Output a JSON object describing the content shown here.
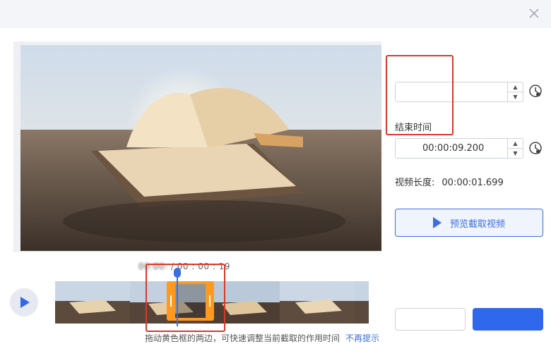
{
  "dialog": {
    "close_icon": "close-icon"
  },
  "timeline": {
    "current_time": "00:00:",
    "separator": " / ",
    "total_time": "00 : 00 : 19",
    "hint": "拖动黄色框的两边，可快速调整当前截取的作用时间",
    "hint_link": "不再提示"
  },
  "panel": {
    "start_time_value": "",
    "end_time_label": "结束时间",
    "end_time_value": "00:00:09.200",
    "duration_label": "视频长度:",
    "duration_value": "00:00:01.699",
    "preview_button": "预览截取视频",
    "cancel_button": "",
    "ok_button": ""
  },
  "colors": {
    "accent": "#2f68ec",
    "selection": "#ff9a1f",
    "highlight": "#d63a2a"
  }
}
